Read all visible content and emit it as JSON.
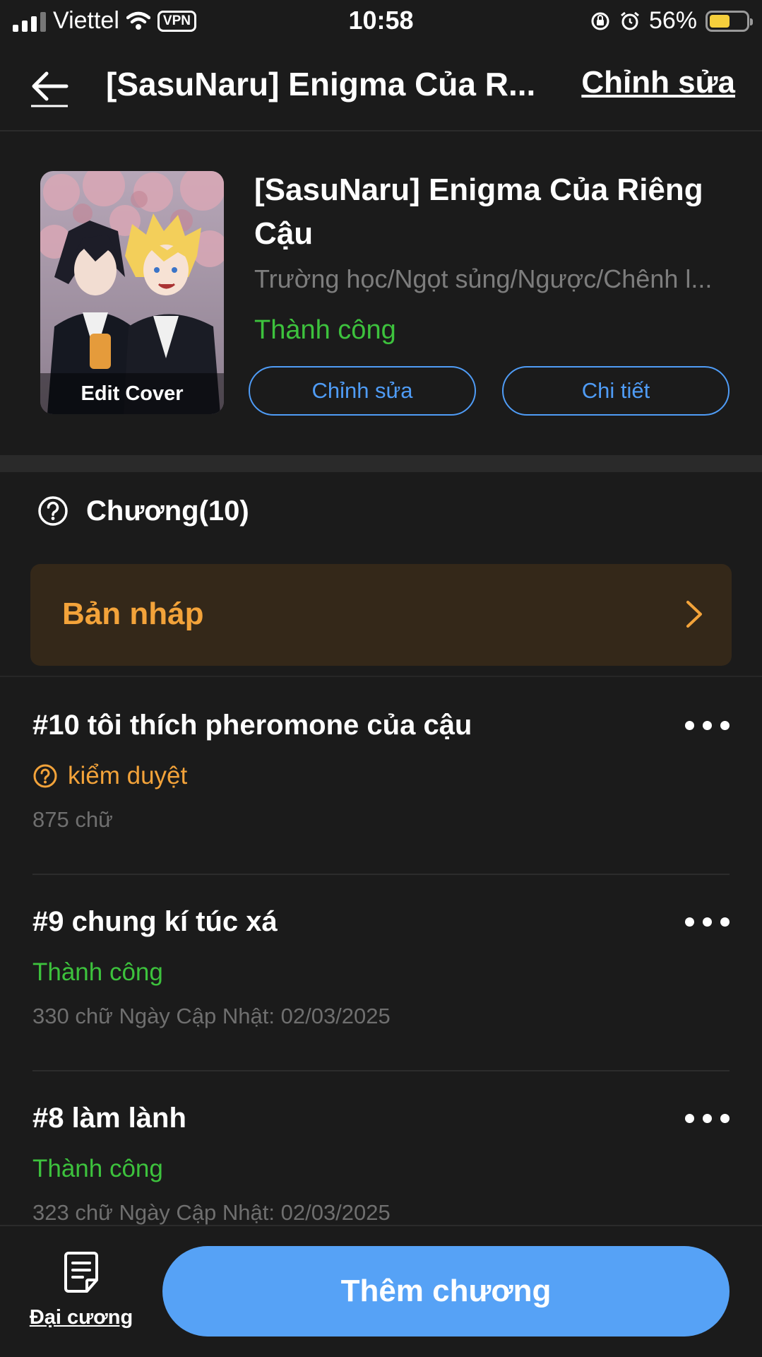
{
  "status_bar": {
    "carrier": "Viettel",
    "vpn": "VPN",
    "time": "10:58",
    "battery": "56%",
    "battery_level": 0.56,
    "battery_color": "#f5cf3c"
  },
  "nav": {
    "title": "[SasuNaru] Enigma Của R...",
    "edit_label": "Chỉnh sửa"
  },
  "book": {
    "cover_label": "Edit Cover",
    "title": "[SasuNaru] Enigma Của Riêng Cậu",
    "genres": "Trường học/Ngọt sủng/Ngược/Chênh l...",
    "status": "Thành công",
    "edit_button": "Chỉnh sửa",
    "detail_button": "Chi tiết"
  },
  "chapters": {
    "header": "Chương(10)",
    "draft_label": "Bản nháp",
    "items": [
      {
        "title": "#10 tôi thích pheromone của cậu",
        "status": "kiểm duyệt",
        "status_type": "review",
        "meta": "875 chữ"
      },
      {
        "title": "#9 chung kí túc xá",
        "status": "Thành công",
        "status_type": "ok",
        "meta": "330 chữ Ngày Cập Nhật: 02/03/2025"
      },
      {
        "title": "#8 làm lành",
        "status": "Thành công",
        "status_type": "ok",
        "meta": "323 chữ Ngày Cập Nhật: 02/03/2025"
      }
    ]
  },
  "bottom": {
    "outline_label": "Đại cương",
    "add_chapter": "Thêm chương"
  },
  "colors": {
    "accent_blue": "#56a2f6",
    "success_green": "#3dc23d",
    "warning_orange": "#f3a33a",
    "background": "#1b1b1b"
  }
}
